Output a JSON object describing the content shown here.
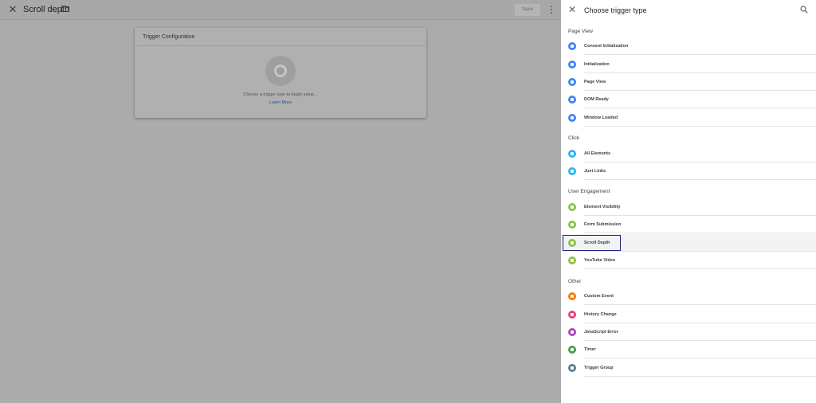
{
  "editor": {
    "title": "Scroll depth",
    "save_label": "Save",
    "card": {
      "title": "Trigger Configuration",
      "hint": "Choose a trigger type to begin setup...",
      "link": "Learn More"
    }
  },
  "panel": {
    "title": "Choose trigger type",
    "sections": {
      "page_view": "Page View",
      "click": "Click",
      "user_engagement": "User Engagement",
      "other": "Other"
    },
    "items": {
      "consent": "Consent Initialization",
      "init": "Initialization",
      "page_view": "Page View",
      "dom_ready": "DOM Ready",
      "window_loaded": "Window Loaded",
      "all_elements": "All Elements",
      "just_links": "Just Links",
      "element_visibility": "Element Visibility",
      "form_submission": "Form Submission",
      "scroll_depth": "Scroll Depth",
      "youtube": "YouTube Video",
      "custom_event": "Custom Event",
      "history_change": "History Change",
      "js_error": "JavaScript Error",
      "timer": "Timer",
      "trigger_group": "Trigger Group"
    },
    "colors": {
      "blue": "#4285f4",
      "cyan": "#29b6f6",
      "green": "#8bc34a",
      "orange": "#f57c00",
      "pink": "#ec407a",
      "purple": "#ab47bc",
      "teal_green": "#43a047",
      "grey": "#607d8b"
    }
  }
}
